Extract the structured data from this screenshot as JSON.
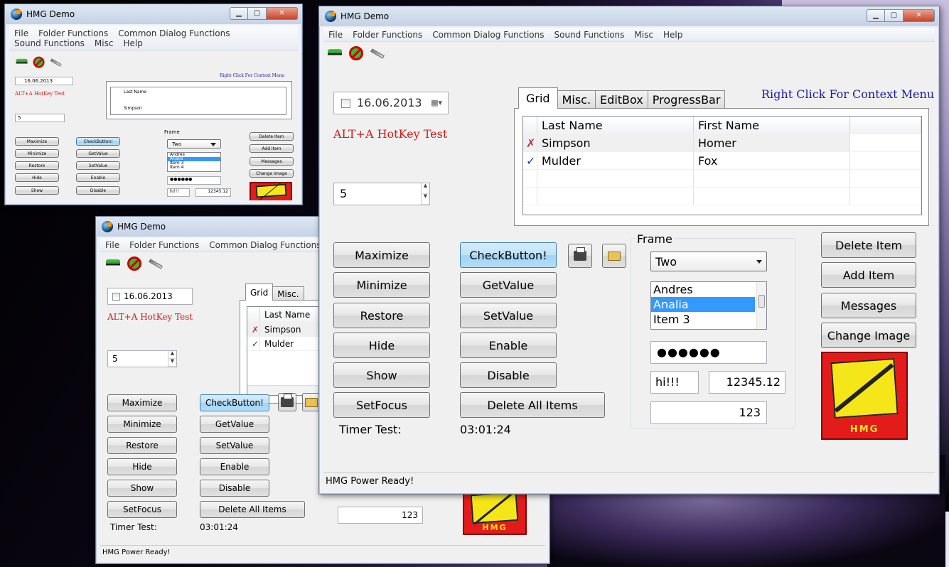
{
  "desktop": {
    "label": "HMG Demo"
  },
  "app": {
    "title": "HMG Demo",
    "menu": [
      "File",
      "Folder Functions",
      "Common Dialog Functions",
      "Sound Functions",
      "Misc",
      "Help"
    ],
    "date": "16.06.2013",
    "hotkey_label": "ALT+A HotKey Test",
    "spinner_value": "5",
    "context_hint": "Right Click For Context Menu",
    "tabs": [
      "Grid",
      "Misc.",
      "EditBox",
      "ProgressBar"
    ],
    "grid": {
      "columns": [
        "Last Name",
        "First Name"
      ],
      "rows": [
        {
          "mark": "✗",
          "last": "Simpson",
          "first": "Homer"
        },
        {
          "mark": "✓",
          "last": "Mulder",
          "first": "Fox"
        }
      ]
    },
    "buttons_left": [
      "Maximize",
      "Minimize",
      "Restore",
      "Hide",
      "Show",
      "SetFocus"
    ],
    "buttons_mid": [
      "CheckButton!",
      "GetValue",
      "SetValue",
      "Enable",
      "Disable"
    ],
    "delete_all": "Delete All Items",
    "frame_label": "Frame",
    "combo_value": "Two",
    "list_items": [
      "Andres",
      "Analia",
      "Item 3",
      "Item 4"
    ],
    "list_selected": "Analia",
    "password": "●●●●●●",
    "text_short": "hi!!!",
    "num_value": "12345.12",
    "int_value": "123",
    "buttons_right": [
      "Delete Item",
      "Add Item",
      "Messages",
      "Change Image"
    ],
    "logo_text": "HMG",
    "timer_label": "Timer Test:",
    "timer_value": "03:01:24",
    "status": "HMG Power Ready!"
  },
  "colors": {
    "accent": "#3399ff",
    "hotkey": "#d21a1a",
    "hint": "#1a1aa8"
  }
}
